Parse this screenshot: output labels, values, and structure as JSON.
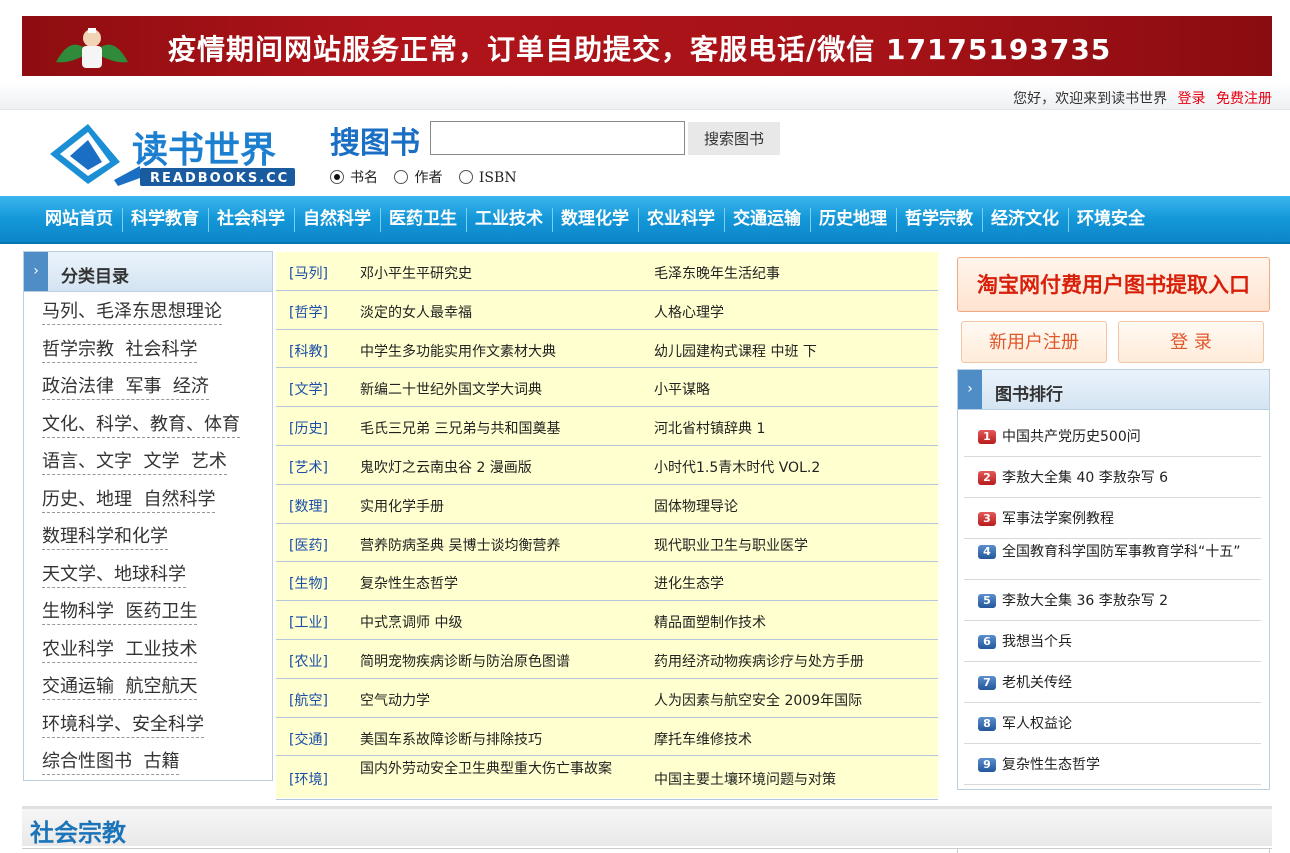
{
  "banner": {
    "text": "疫情期间网站服务正常，订单自助提交，客服电话/微信 17175193735"
  },
  "welcome": {
    "greeting": "您好，欢迎来到读书世界",
    "login": "登录",
    "register": "免费注册"
  },
  "header": {
    "logo_cn": "读书世界",
    "logo_en": "READBOOKS.CC",
    "search_title": "搜图书",
    "search_value": "",
    "search_button": "搜索图书",
    "options": [
      {
        "label": "书名",
        "checked": true
      },
      {
        "label": "作者",
        "checked": false
      },
      {
        "label": "ISBN",
        "checked": false
      }
    ]
  },
  "nav": [
    "网站首页",
    "科学教育",
    "社会科学",
    "自然科学",
    "医药卫生",
    "工业技术",
    "数理化学",
    "农业科学",
    "交通运输",
    "历史地理",
    "哲学宗教",
    "经济文化",
    "环境安全"
  ],
  "category": {
    "title": "分类目录",
    "items": [
      "马列、毛泽东思想理论",
      "哲学宗教  社会科学",
      "政治法律  军事  经济",
      "文化、科学、教育、体育",
      "语言、文字  文学  艺术",
      "历史、地理  自然科学",
      "数理科学和化学",
      "天文学、地球科学",
      "生物科学  医药卫生",
      "农业科学  工业技术",
      "交通运输  航空航天",
      "环境科学、安全科学",
      "综合性图书  古籍"
    ]
  },
  "books": [
    {
      "tag": "[马列]",
      "b1": "邓小平生平研究史",
      "b2": "毛泽东晚年生活纪事"
    },
    {
      "tag": "[哲学]",
      "b1": "淡定的女人最幸福",
      "b2": "人格心理学"
    },
    {
      "tag": "[科教]",
      "b1": "中学生多功能实用作文素材大典",
      "b2": "幼儿园建构式课程 中班 下"
    },
    {
      "tag": "[文学]",
      "b1": "新编二十世纪外国文学大词典",
      "b2": "小平谋略"
    },
    {
      "tag": "[历史]",
      "b1": "毛氏三兄弟 三兄弟与共和国奠基",
      "b2": "河北省村镇辞典 1"
    },
    {
      "tag": "[艺术]",
      "b1": "鬼吹灯之云南虫谷 2 漫画版",
      "b2": "小时代1.5青木时代 VOL.2"
    },
    {
      "tag": "[数理]",
      "b1": "实用化学手册",
      "b2": "固体物理导论"
    },
    {
      "tag": "[医药]",
      "b1": "营养防病圣典 吴博士谈均衡营养",
      "b2": "现代职业卫生与职业医学"
    },
    {
      "tag": "[生物]",
      "b1": "复杂性生态哲学",
      "b2": "进化生态学"
    },
    {
      "tag": "[工业]",
      "b1": "中式烹调师 中级",
      "b2": "精品面塑制作技术"
    },
    {
      "tag": "[农业]",
      "b1": "简明宠物疾病诊断与防治原色图谱",
      "b2": "药用经济动物疾病诊疗与处方手册"
    },
    {
      "tag": "[航空]",
      "b1": "空气动力学",
      "b2": "人为因素与航空安全 2009年国际"
    },
    {
      "tag": "[交通]",
      "b1": "美国车系故障诊断与排除技巧",
      "b2": "摩托车维修技术"
    },
    {
      "tag": "[环境]",
      "b1": "国内外劳动安全卫生典型重大伤亡事故案",
      "b2": "中国主要土壤环境问题与对策"
    }
  ],
  "right": {
    "taobao": "淘宝网付费用户图书提取入口",
    "register": "新用户注册",
    "login": "登 录",
    "rank_title": "图书排行",
    "rank": [
      {
        "num": "1",
        "title": "中国共产党历史500问"
      },
      {
        "num": "2",
        "title": "李敖大全集 40 李敖杂写 6"
      },
      {
        "num": "3",
        "title": "军事法学案例教程"
      },
      {
        "num": "4",
        "title": "全国教育科学国防军事教育学科“十五”"
      },
      {
        "num": "5",
        "title": "李敖大全集 36 李敖杂写 2"
      },
      {
        "num": "6",
        "title": "我想当个兵"
      },
      {
        "num": "7",
        "title": "老机关传经"
      },
      {
        "num": "8",
        "title": "军人权益论"
      },
      {
        "num": "9",
        "title": "复杂性生态哲学"
      }
    ]
  },
  "section": {
    "title": "社会宗教"
  },
  "colors": {
    "nav": "#1497d8",
    "banner": "#a51217",
    "link_red": "#e60012",
    "table_bg": "#ffffcf"
  }
}
